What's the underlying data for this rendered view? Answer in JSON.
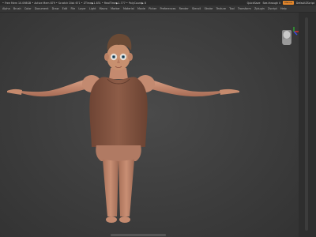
{
  "status_bar": {
    "text": "• Free Mem 10.098GB • Active Mem 879 • Scratch Disk 671 • ZTime▶1.831 • RealTime▶1.777 • PolyCount▶ 8",
    "quick_save": "QuickSave",
    "menus_toggle": "See-through 0",
    "menus_button": "Menus",
    "default_script": "DefaultZScript"
  },
  "menu_bar": {
    "items": [
      "Alpha",
      "Brush",
      "Color",
      "Document",
      "Draw",
      "Edit",
      "File",
      "Layer",
      "Light",
      "Macro",
      "Marker",
      "Material",
      "Movie",
      "Picker",
      "Preferences",
      "Render",
      "Stencil",
      "Stroke",
      "Texture",
      "Tool",
      "Transform",
      "Zplugin",
      "Zscript",
      "Help"
    ]
  },
  "viewport": {
    "model": "mannequin-character",
    "colors": {
      "background": "#3a3a3a",
      "skin": "#c58a6d",
      "shirt": "#8a5a45",
      "hair": "#6a4a35"
    }
  },
  "colors": {
    "accent": "#e3862b",
    "axis_x": "#d23030",
    "axis_y": "#30a030",
    "axis_z": "#3050e0"
  }
}
